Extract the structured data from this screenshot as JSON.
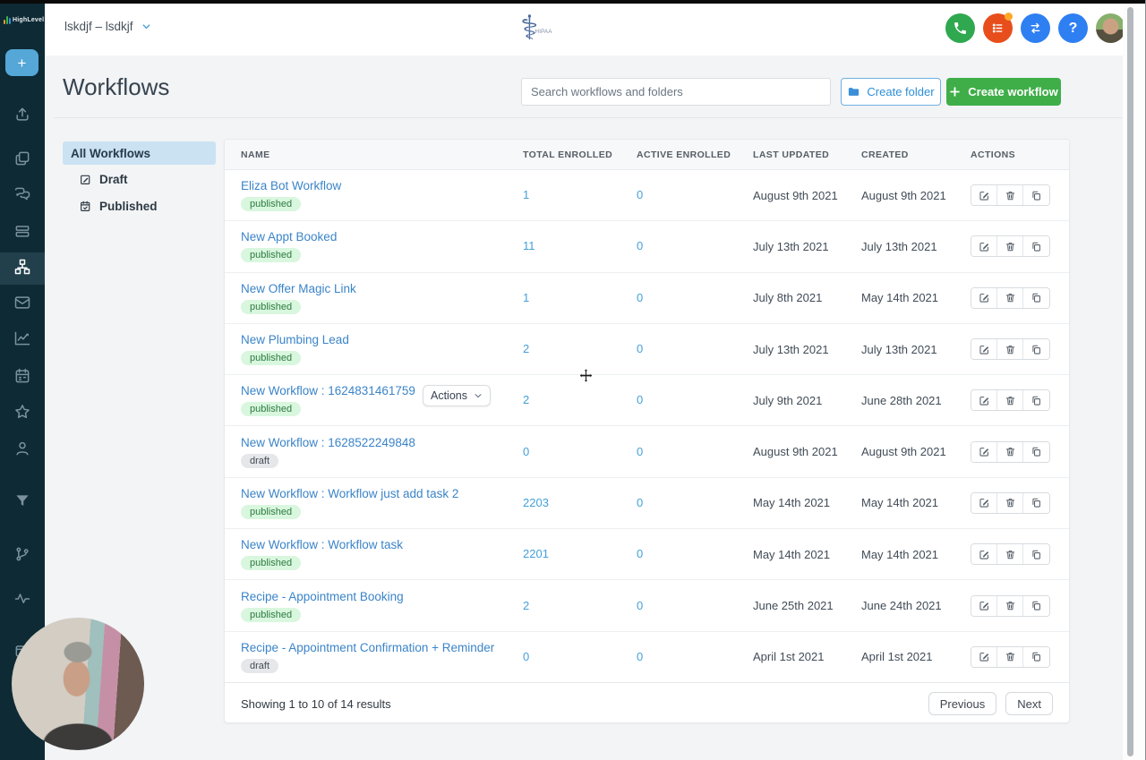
{
  "topbar": {
    "brand": "HighLevel",
    "account_switcher": "lskdjf – lsdkjf",
    "hipaa_label": "HIPAA",
    "hipaa_symbol": "⚕",
    "help_label": "?"
  },
  "sidebar": {
    "create_label": "+",
    "items": [
      {
        "id": "launchpad",
        "icon": "launch-icon",
        "active": false
      },
      {
        "id": "dashboard",
        "icon": "pages-icon",
        "active": false
      },
      {
        "id": "conversations",
        "icon": "chat-icon",
        "active": false
      },
      {
        "id": "opportunities",
        "icon": "pipeline-icon",
        "active": false
      },
      {
        "id": "workflows",
        "icon": "sitemap-icon",
        "active": true
      },
      {
        "id": "email",
        "icon": "envelope-icon",
        "active": false
      },
      {
        "id": "reporting",
        "icon": "chart-icon",
        "active": false
      },
      {
        "id": "calendar",
        "icon": "calendar-icon",
        "active": false
      },
      {
        "id": "reviews",
        "icon": "star-icon",
        "active": false
      },
      {
        "id": "contacts",
        "icon": "person-icon",
        "active": false
      },
      {
        "id": "funnels",
        "icon": "funnel-icon",
        "active": false
      },
      {
        "id": "triggers",
        "icon": "branch-icon",
        "active": false
      },
      {
        "id": "activity",
        "icon": "pulse-icon",
        "active": false
      },
      {
        "id": "sites",
        "icon": "window-icon",
        "active": false
      }
    ]
  },
  "page": {
    "title": "Workflows",
    "search_placeholder": "Search workflows and folders",
    "create_folder_label": "Create folder",
    "create_workflow_label": "Create workflow"
  },
  "filters": {
    "all_label": "All Workflows",
    "draft_label": "Draft",
    "published_label": "Published"
  },
  "table": {
    "columns": [
      "Name",
      "Total Enrolled",
      "Active Enrolled",
      "Last Updated",
      "Created",
      "Actions"
    ],
    "row_actions_label": "Actions",
    "rows": [
      {
        "name": "Eliza Bot Workflow",
        "status": "published",
        "total": "1",
        "active": "0",
        "updated": "August 9th 2021",
        "created": "August 9th 2021"
      },
      {
        "name": "New Appt Booked",
        "status": "published",
        "total": "11",
        "active": "0",
        "updated": "July 13th 2021",
        "created": "July 13th 2021"
      },
      {
        "name": "New Offer Magic Link",
        "status": "published",
        "total": "1",
        "active": "0",
        "updated": "July 8th 2021",
        "created": "May 14th 2021"
      },
      {
        "name": "New Plumbing Lead",
        "status": "published",
        "total": "2",
        "active": "0",
        "updated": "July 13th 2021",
        "created": "July 13th 2021"
      },
      {
        "name": "New Workflow : 1624831461759",
        "status": "published",
        "total": "2",
        "active": "0",
        "updated": "July 9th 2021",
        "created": "June 28th 2021",
        "has_actions_menu": true
      },
      {
        "name": "New Workflow : 1628522249848",
        "status": "draft",
        "total": "0",
        "active": "0",
        "updated": "August 9th 2021",
        "created": "August 9th 2021"
      },
      {
        "name": "New Workflow : Workflow just add task 2",
        "status": "published",
        "total": "2203",
        "active": "0",
        "updated": "May 14th 2021",
        "created": "May 14th 2021"
      },
      {
        "name": "New Workflow : Workflow task",
        "status": "published",
        "total": "2201",
        "active": "0",
        "updated": "May 14th 2021",
        "created": "May 14th 2021"
      },
      {
        "name": "Recipe - Appointment Booking",
        "status": "published",
        "total": "2",
        "active": "0",
        "updated": "June 25th 2021",
        "created": "June 24th 2021"
      },
      {
        "name": "Recipe - Appointment Confirmation + Reminder",
        "status": "draft",
        "total": "0",
        "active": "0",
        "updated": "April 1st 2021",
        "created": "April 1st 2021"
      }
    ]
  },
  "pagination": {
    "summary": "Showing 1 to 10 of 14 results",
    "previous_label": "Previous",
    "next_label": "Next"
  },
  "colors": {
    "sidebar_bg": "#0e2a35",
    "accent_blue": "#3b84c8",
    "number_blue": "#45a0d8",
    "green_button": "#3fae49",
    "phone_green": "#2fa84f",
    "list_orange": "#e84e1c",
    "circle_blue": "#2e7ff2",
    "badge_published_bg": "#d9f7de",
    "badge_published_text": "#2c7a3f",
    "badge_draft_bg": "#e5e7ea",
    "badge_draft_text": "#454d55"
  }
}
